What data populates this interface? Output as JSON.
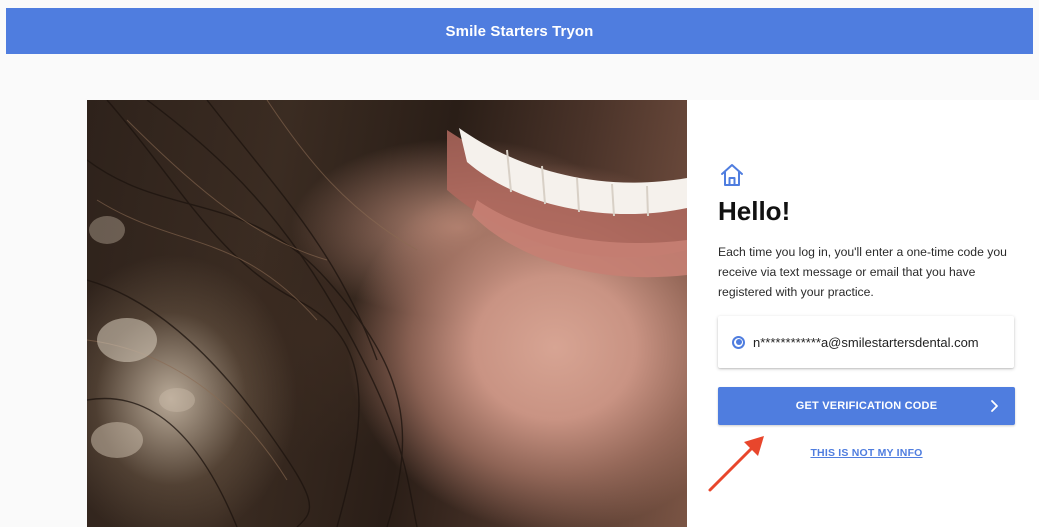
{
  "header": {
    "title": "Smile Starters Tryon"
  },
  "login": {
    "icon": "home-icon",
    "heading": "Hello!",
    "description": "Each time you log in, you'll enter a one-time code you receive via text message or email that you have registered with your practice.",
    "contact_option": {
      "label": "n************a@smilestartersdental.com",
      "selected": true
    },
    "verify_button_label": "GET VERIFICATION CODE",
    "not_my_info_label": "THIS IS NOT MY INFO"
  },
  "colors": {
    "accent": "#4f7ddf",
    "annotation_arrow": "#e8462c"
  }
}
